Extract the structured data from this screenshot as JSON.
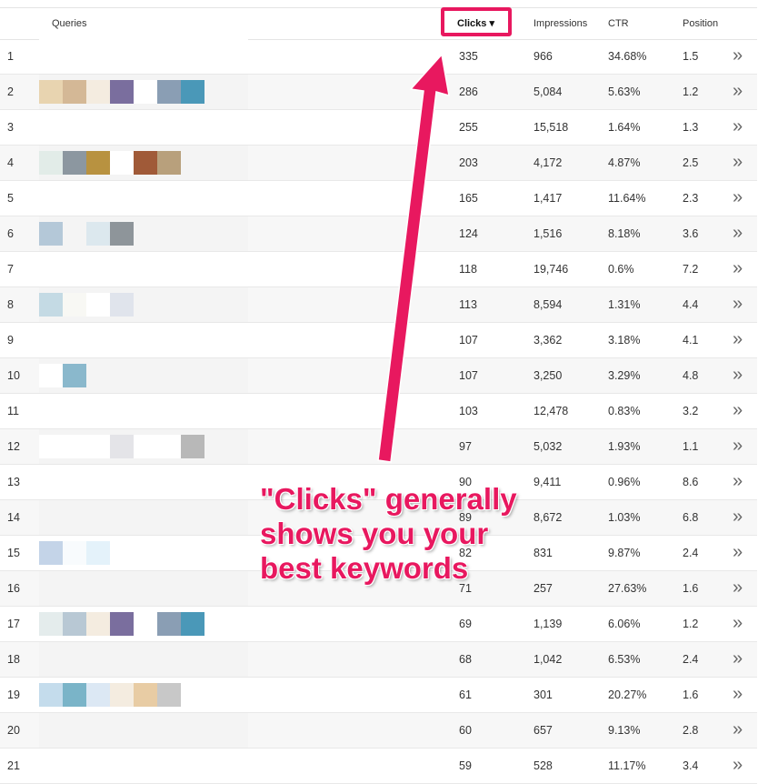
{
  "header": {
    "queries": "Queries",
    "clicks": "Clicks ▾",
    "impressions": "Impressions",
    "ctr": "CTR",
    "position": "Position"
  },
  "rows": [
    {
      "idx": "1",
      "clicks": "335",
      "impressions": "966",
      "ctr": "34.68%",
      "position": "1.5",
      "chips": []
    },
    {
      "idx": "2",
      "clicks": "286",
      "impressions": "5,084",
      "ctr": "5.63%",
      "position": "1.2",
      "chips": [
        "#e8d4b0",
        "#d4b896",
        "#f4ece0",
        "#7a6e9e",
        "#ffffff",
        "#8a9eb4",
        "#4a98b8"
      ]
    },
    {
      "idx": "3",
      "clicks": "255",
      "impressions": "15,518",
      "ctr": "1.64%",
      "position": "1.3",
      "chips": []
    },
    {
      "idx": "4",
      "clicks": "203",
      "impressions": "4,172",
      "ctr": "4.87%",
      "position": "2.5",
      "chips": [
        "#e2ece8",
        "#8c97a0",
        "#b89240",
        "#ffffff",
        "#a05a38",
        "#b8a07c"
      ]
    },
    {
      "idx": "5",
      "clicks": "165",
      "impressions": "1,417",
      "ctr": "11.64%",
      "position": "2.3",
      "chips": []
    },
    {
      "idx": "6",
      "clicks": "124",
      "impressions": "1,516",
      "ctr": "8.18%",
      "position": "3.6",
      "chips": [
        "#b4c8d8",
        "#f4f4f4",
        "#dce8ee",
        "#8e959a"
      ]
    },
    {
      "idx": "7",
      "clicks": "118",
      "impressions": "19,746",
      "ctr": "0.6%",
      "position": "7.2",
      "chips": []
    },
    {
      "idx": "8",
      "clicks": "113",
      "impressions": "8,594",
      "ctr": "1.31%",
      "position": "4.4",
      "chips": [
        "#c4dae4",
        "#f8f8f4",
        "#ffffff",
        "#e0e4ec"
      ]
    },
    {
      "idx": "9",
      "clicks": "107",
      "impressions": "3,362",
      "ctr": "3.18%",
      "position": "4.1",
      "chips": []
    },
    {
      "idx": "10",
      "clicks": "107",
      "impressions": "3,250",
      "ctr": "3.29%",
      "position": "4.8",
      "chips": [
        "#ffffff",
        "#8ab8cc"
      ]
    },
    {
      "idx": "11",
      "clicks": "103",
      "impressions": "12,478",
      "ctr": "0.83%",
      "position": "3.2",
      "chips": []
    },
    {
      "idx": "12",
      "clicks": "97",
      "impressions": "5,032",
      "ctr": "1.93%",
      "position": "1.1",
      "chips": [
        "#ffffff",
        "#ffffff",
        "#ffffff",
        "#e4e4e8",
        "#ffffff",
        "#ffffff",
        "#b8b8b8"
      ]
    },
    {
      "idx": "13",
      "clicks": "90",
      "impressions": "9,411",
      "ctr": "0.96%",
      "position": "8.6",
      "chips": []
    },
    {
      "idx": "14",
      "clicks": "89",
      "impressions": "8,672",
      "ctr": "1.03%",
      "position": "6.8",
      "chips": []
    },
    {
      "idx": "15",
      "clicks": "82",
      "impressions": "831",
      "ctr": "9.87%",
      "position": "2.4",
      "chips": [
        "#c4d4e8",
        "#f8fbfd",
        "#e4f2fa"
      ]
    },
    {
      "idx": "16",
      "clicks": "71",
      "impressions": "257",
      "ctr": "27.63%",
      "position": "1.6",
      "chips": []
    },
    {
      "idx": "17",
      "clicks": "69",
      "impressions": "1,139",
      "ctr": "6.06%",
      "position": "1.2",
      "chips": [
        "#e4ecec",
        "#b8c8d4",
        "#f4ece0",
        "#7a6e9e",
        "#ffffff",
        "#8a9eb4",
        "#4a98b8"
      ]
    },
    {
      "idx": "18",
      "clicks": "68",
      "impressions": "1,042",
      "ctr": "6.53%",
      "position": "2.4",
      "chips": []
    },
    {
      "idx": "19",
      "clicks": "61",
      "impressions": "301",
      "ctr": "20.27%",
      "position": "1.6",
      "chips": [
        "#c4dcec",
        "#7ab4c8",
        "#dce8f4",
        "#f4ece0",
        "#e8cca4",
        "#c8c8c8"
      ]
    },
    {
      "idx": "20",
      "clicks": "60",
      "impressions": "657",
      "ctr": "9.13%",
      "position": "2.8",
      "chips": []
    },
    {
      "idx": "21",
      "clicks": "59",
      "impressions": "528",
      "ctr": "11.17%",
      "position": "3.4",
      "chips": []
    }
  ],
  "callout": {
    "line1": "\"Clicks\" generally",
    "line2": "shows you your",
    "line3": "best keywords"
  },
  "colors": {
    "accent": "#e8185f"
  },
  "icons": {
    "row_more": "double-chevron-right-icon"
  }
}
